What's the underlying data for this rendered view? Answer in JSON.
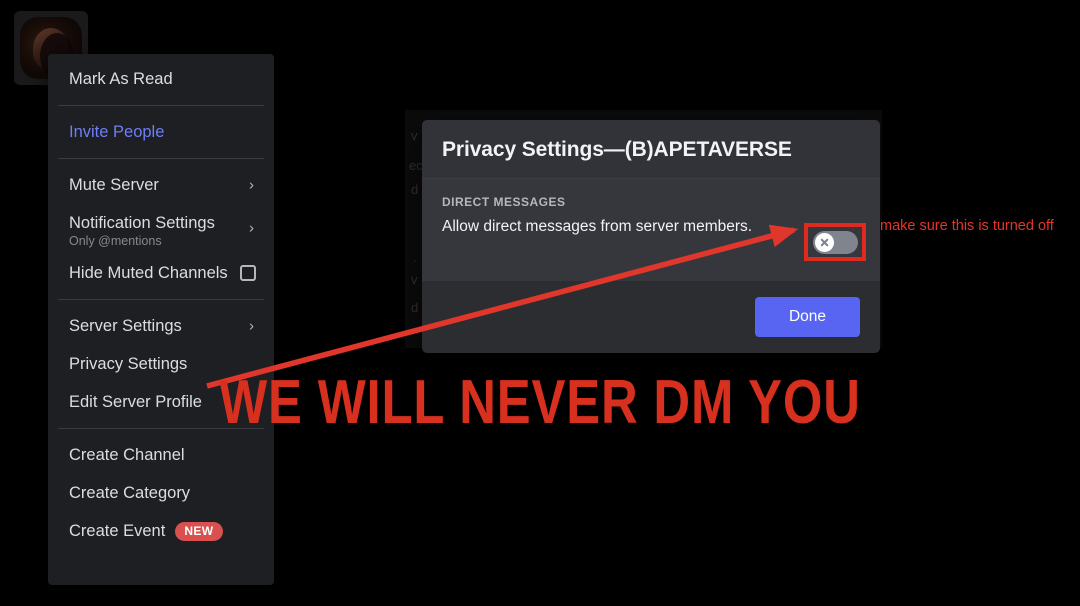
{
  "colors": {
    "menu_bg": "#1e1f22",
    "modal_header_bg": "#313338",
    "modal_body_bg": "#36373d",
    "modal_footer_bg": "#2b2d31",
    "accent_blurple": "#5865f2",
    "link_blurple": "#6e7ef5",
    "annotation_red": "#e02a20",
    "badge_red": "#d8504f"
  },
  "server_avatar": {
    "name": "server-icon",
    "badge": ""
  },
  "context_menu": {
    "items": [
      {
        "label": "Mark As Read",
        "type": "item"
      },
      {
        "label": "Invite People",
        "type": "link"
      },
      {
        "label": "Mute Server",
        "type": "submenu"
      },
      {
        "label": "Notification Settings",
        "sub": "Only @mentions",
        "type": "submenu"
      },
      {
        "label": "Hide Muted Channels",
        "type": "checkbox",
        "checked": false
      },
      {
        "label": "Server Settings",
        "type": "submenu"
      },
      {
        "label": "Privacy Settings",
        "type": "item"
      },
      {
        "label": "Edit Server Profile",
        "type": "item"
      },
      {
        "label": "Create Channel",
        "type": "item"
      },
      {
        "label": "Create Category",
        "type": "item"
      },
      {
        "label": "Create Event",
        "type": "item",
        "badge": "NEW"
      }
    ]
  },
  "modal": {
    "title": "Privacy Settings—(B)APETAVERSE",
    "section_label": "DIRECT MESSAGES",
    "dm_description": "Allow direct messages from server members.",
    "toggle_state": "off",
    "done_label": "Done"
  },
  "annotations": {
    "note": "make sure this is turned off",
    "banner": "WE WILL NEVER DM YOU"
  },
  "background_app": {
    "ghost_channels": [
      "v",
      "ec",
      "d",
      ".",
      "v",
      "d"
    ]
  }
}
